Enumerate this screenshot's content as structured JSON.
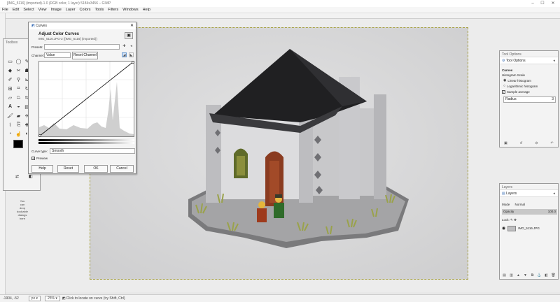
{
  "window": {
    "title": "[IMG_5116] (imported)-1.0 (RGB color, 1 layer) 5184x3456 – GIMP",
    "controls": [
      "–",
      "☐",
      "✕"
    ]
  },
  "menu": [
    "File",
    "Edit",
    "Select",
    "View",
    "Image",
    "Layer",
    "Colors",
    "Tools",
    "Filters",
    "Windows",
    "Help"
  ],
  "toolbox": {
    "title": "Toolbox",
    "drop_hint": [
      "You",
      "can",
      "drop",
      "dockable",
      "dialogs",
      "here"
    ]
  },
  "curves": {
    "window_title": "Curves",
    "heading": "Adjust Color Curves",
    "subheading": "IMG_5116.JPG-2 ([IMG_5116] (imported))",
    "presets_label": "Presets:",
    "channel_label": "Channel:",
    "channel_value": "Value",
    "reset_channel": "Reset Channel",
    "curve_type_label": "Curve type:",
    "curve_type_value": "Smooth",
    "preview_label": "Preview",
    "buttons": {
      "help": "Help",
      "reset": "Reset",
      "ok": "OK",
      "cancel": "Cancel"
    }
  },
  "tool_options": {
    "dock_title": "Tool Options",
    "tab": "Tool Options",
    "section": "Curves",
    "histogram_scale": "Histogram Scale",
    "linear": "Linear histogram",
    "log": "Logarithmic histogram",
    "sample_average": "Sample average",
    "radius_label": "Radius",
    "radius_value": "3"
  },
  "layers": {
    "dock_title": "Layers",
    "tab": "Layers",
    "mode_label": "Mode",
    "mode_value": "Normal",
    "opacity_label": "Opacity",
    "opacity_value": "100.0",
    "lock_label": "Lock:",
    "layer_name": "IMG_5116.JPG"
  },
  "status": {
    "coords": "-1904, -52",
    "unit": "px",
    "zoom": "25%",
    "message": "Click to locate on curve (try Shift, Ctrl)"
  },
  "colors": {
    "accent": "#3b6fb6",
    "canvas": "#ececec",
    "photo_bg": "#d7d7d8"
  }
}
